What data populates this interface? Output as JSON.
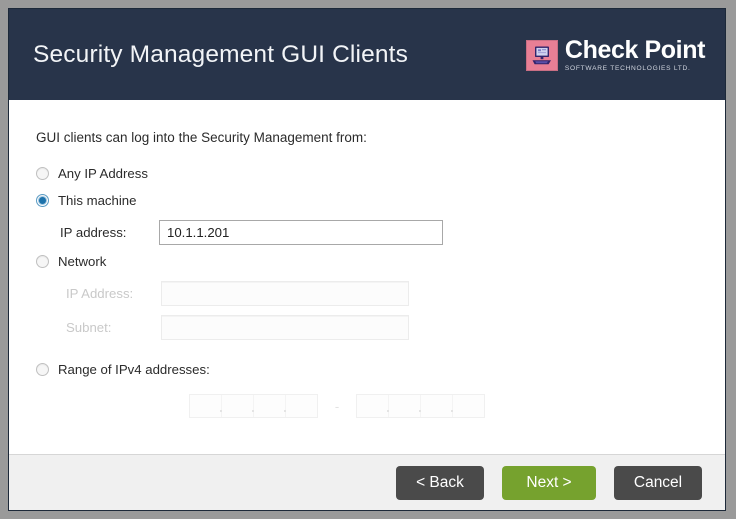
{
  "header": {
    "title": "Security Management GUI Clients",
    "logo": {
      "name": "Check Point",
      "tagline": "SOFTWARE TECHNOLOGIES LTD.",
      "mark_icon": "computer-monitor-icon",
      "mark_color": "#e87f95",
      "background_color": "#28344a"
    }
  },
  "main": {
    "intro": "GUI clients can log into the Security Management from:",
    "options": [
      {
        "id": "any-ip",
        "label": "Any IP Address",
        "selected": false,
        "enabled": true
      },
      {
        "id": "this-machine",
        "label": "This machine",
        "selected": true,
        "enabled": true
      },
      {
        "id": "network",
        "label": "Network",
        "selected": false,
        "enabled": true
      },
      {
        "id": "range-ipv4",
        "label": "Range of IPv4 addresses:",
        "selected": false,
        "enabled": true
      }
    ],
    "this_machine": {
      "ip_label": "IP address:",
      "ip_value": "10.1.1.201",
      "ip_placeholder": ""
    },
    "network": {
      "ip_label": "IP Address:",
      "ip_value": "",
      "subnet_label": "Subnet:",
      "subnet_value": "",
      "disabled": true
    },
    "range": {
      "start_value": "",
      "end_value": "",
      "separator": "-",
      "octets_per_field": 4,
      "disabled": true
    }
  },
  "footer": {
    "back_label": "< Back",
    "next_label": "Next >",
    "cancel_label": "Cancel",
    "next_color": "#76a22e",
    "grey_color": "#4a4a4a"
  }
}
